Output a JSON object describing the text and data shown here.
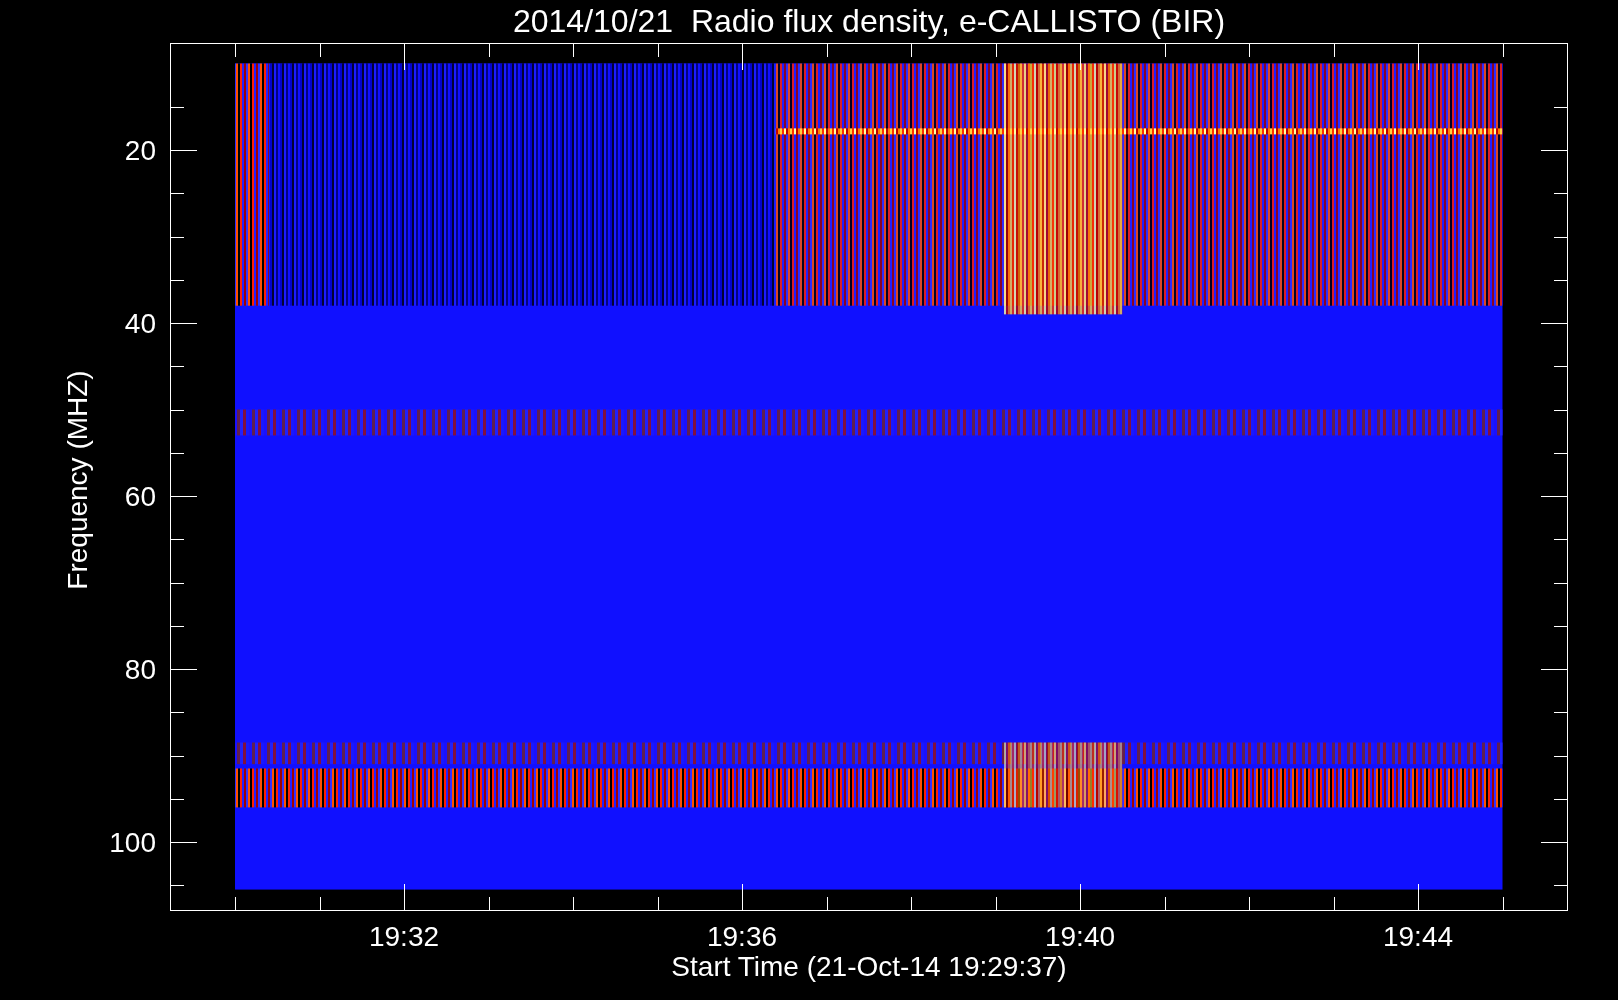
{
  "title": "2014/10/21  Radio flux density, e-CALLISTO (BIR)",
  "ylabel": "Frequency (MHZ)",
  "xlabel": "Start Time (21-Oct-14 19:29:37)",
  "y_tick_labels": [
    "20",
    "40",
    "60",
    "80",
    "100"
  ],
  "x_tick_labels": [
    "19:32",
    "19:36",
    "19:40",
    "19:44"
  ]
}
